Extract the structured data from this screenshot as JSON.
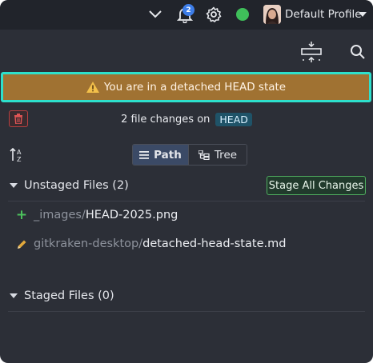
{
  "topbar": {
    "notification_count": "2",
    "profile_name": "Default Profile",
    "status_color": "#3fbf5a",
    "icons": [
      "chevron-down-icon",
      "bell-icon",
      "gear-icon",
      "status-dot",
      "avatar",
      "caret-down-icon"
    ]
  },
  "toolbar": {
    "icons": [
      "collapse-panel-icon",
      "search-icon"
    ]
  },
  "banner": {
    "text": "You are in a detached HEAD state",
    "icon": "warning-icon",
    "background": "#a07232",
    "highlight": "#2de0cc"
  },
  "changes": {
    "summary": "2 file changes on",
    "ref": "HEAD",
    "discard_icon": "trash-icon"
  },
  "view_toggle": {
    "path_label": "Path",
    "tree_label": "Tree",
    "selected": "Path",
    "sort_icon": "sort-az-icon"
  },
  "unstaged": {
    "title": "Unstaged Files (2)",
    "stage_all_label": "Stage All Changes",
    "files": [
      {
        "status_icon": "plus-icon",
        "dir": "_images/",
        "name": "HEAD-2025.png"
      },
      {
        "status_icon": "pencil-icon",
        "dir": "gitkraken-desktop/",
        "name": "detached-head-state.md"
      }
    ]
  },
  "staged": {
    "title": "Staged Files (0)"
  }
}
